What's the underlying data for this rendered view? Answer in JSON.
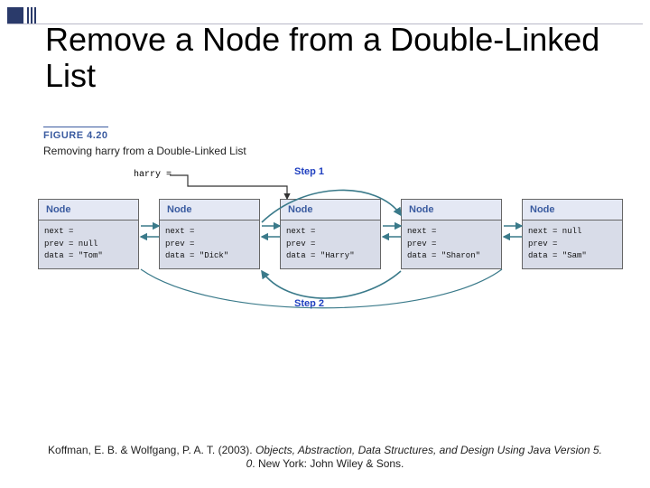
{
  "title": "Remove a Node from a Double-Linked List",
  "figure": {
    "label": "FIGURE 4.20",
    "caption": "Removing harry from a Double-Linked List"
  },
  "harry": "harry =",
  "steps": {
    "s1": "Step 1",
    "s2": "Step 2"
  },
  "nodeHeader": "Node",
  "nodes": [
    {
      "next": "next =",
      "prev": "prev = null",
      "data": "data = \"Tom\""
    },
    {
      "next": "next =",
      "prev": "prev =",
      "data": "data = \"Dick\""
    },
    {
      "next": "next =",
      "prev": "prev =",
      "data": "data = \"Harry\""
    },
    {
      "next": "next =",
      "prev": "prev =",
      "data": "data = \"Sharon\""
    },
    {
      "next": "next = null",
      "prev": "prev =",
      "data": "data = \"Sam\""
    }
  ],
  "citation": {
    "l1": "Koffman, E. B. & Wolfgang, P. A. T. (2003). ",
    "l1i": "Objects, Abstraction, Data Structures, and Design Using Java Version 5. 0",
    "l2": ". New York: John Wiley & Sons."
  }
}
